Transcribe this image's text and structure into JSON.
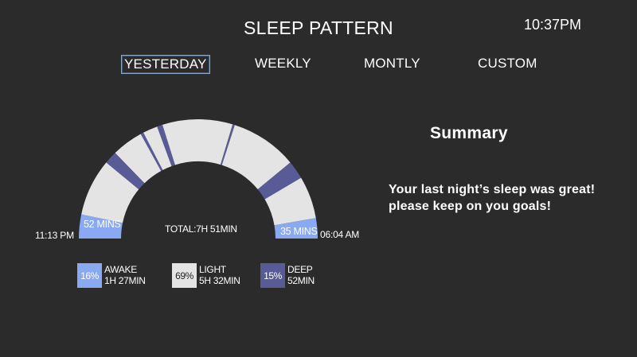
{
  "header": {
    "title": "SLEEP PATTERN",
    "time": "10:37PM"
  },
  "tabs": [
    {
      "label": "YESTERDAY",
      "active": true
    },
    {
      "label": "WEEKLY",
      "active": false
    },
    {
      "label": "MONTLY",
      "active": false
    },
    {
      "label": "CUSTOM",
      "active": false
    }
  ],
  "gauge": {
    "start_time": "11:13 PM",
    "end_time": "06:04 AM",
    "total": "TOTAL:7H 51MIN",
    "start_segment_label": "52 MINS",
    "end_segment_label": "35 MINS"
  },
  "legend": [
    {
      "percent": "16%",
      "name": "AWAKE",
      "duration": "1H 27MIN",
      "color": "#89a9f2"
    },
    {
      "percent": "69%",
      "name": "LIGHT",
      "duration": "5H 32MIN",
      "color": "#e4e4e4"
    },
    {
      "percent": "15%",
      "name": "DEEP",
      "duration": "52MIN",
      "color": "#595b96"
    }
  ],
  "summary": {
    "title": "Summary",
    "line1": "Your last night’s sleep was great!",
    "line2": "please keep on you goals!"
  },
  "colors": {
    "background": "#2b2b2b",
    "awake": "#89a9f2",
    "light": "#e4e4e4",
    "deep": "#595b96"
  },
  "sleep_timeline": [
    {
      "stage": "awake",
      "fraction": 0.065
    },
    {
      "stage": "light",
      "fraction": 0.155
    },
    {
      "stage": "deep",
      "fraction": 0.035
    },
    {
      "stage": "light",
      "fraction": 0.085
    },
    {
      "stage": "deep",
      "fraction": 0.008
    },
    {
      "stage": "light",
      "fraction": 0.04
    },
    {
      "stage": "deep",
      "fraction": 0.015
    },
    {
      "stage": "light",
      "fraction": 0.19
    },
    {
      "stage": "deep",
      "fraction": 0.006
    },
    {
      "stage": "light",
      "fraction": 0.181
    },
    {
      "stage": "deep",
      "fraction": 0.05
    },
    {
      "stage": "light",
      "fraction": 0.115
    },
    {
      "stage": "awake",
      "fraction": 0.055
    }
  ]
}
